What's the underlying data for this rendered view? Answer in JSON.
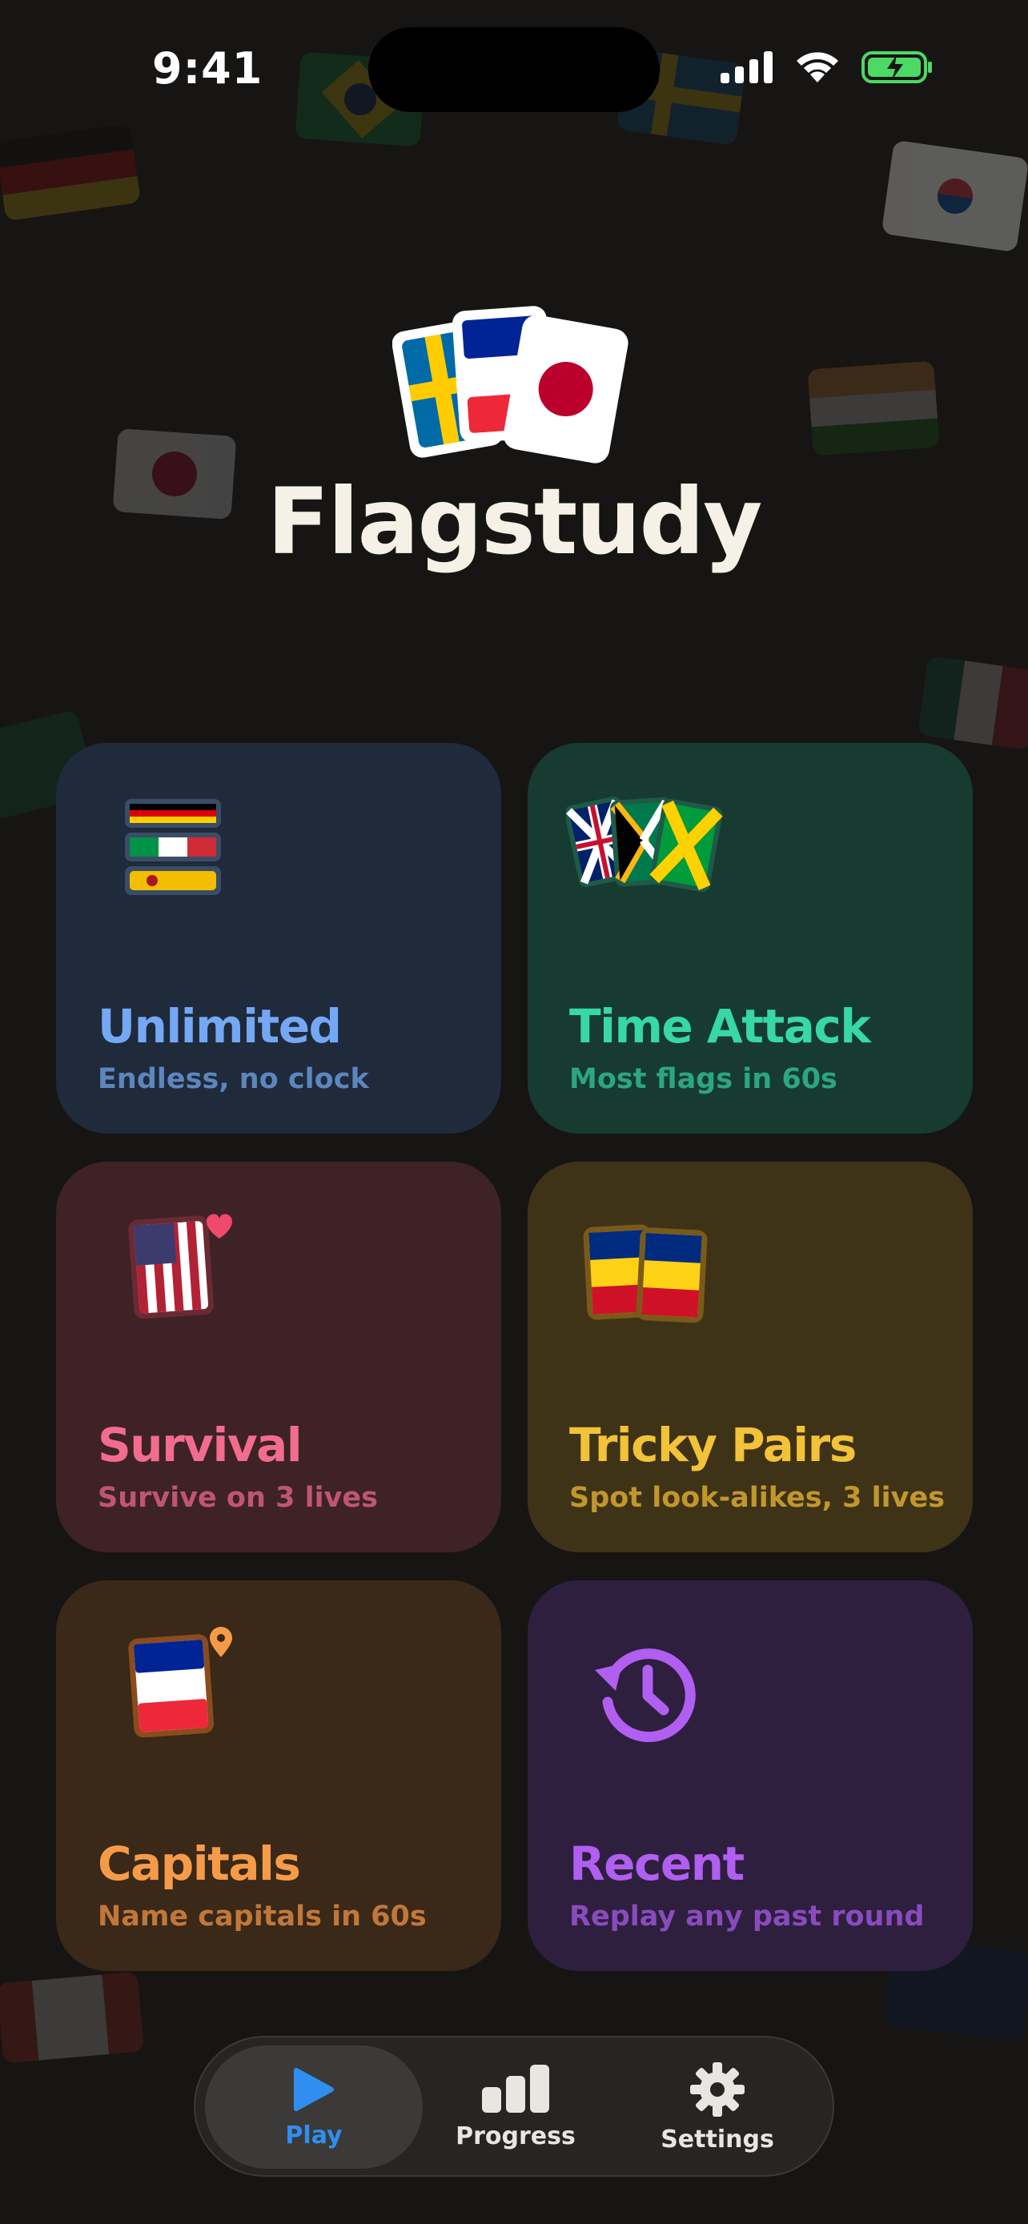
{
  "status_bar": {
    "time": "9:41"
  },
  "app": {
    "title": "Flagstudy"
  },
  "modes": [
    {
      "label": "Unlimited",
      "subtitle": "Endless, no clock",
      "accent": "#74a8f4"
    },
    {
      "label": "Time Attack",
      "subtitle": "Most flags in 60s",
      "accent": "#37d8a5"
    },
    {
      "label": "Survival",
      "subtitle": "Survive on 3 lives",
      "accent": "#f26c8e"
    },
    {
      "label": "Tricky Pairs",
      "subtitle": "Spot look-alikes, 3 lives",
      "accent": "#f2c238"
    },
    {
      "label": "Capitals",
      "subtitle": "Name capitals in 60s",
      "accent": "#f59b48"
    },
    {
      "label": "Recent",
      "subtitle": "Replay any past round",
      "accent": "#b05ff0"
    }
  ],
  "tabs": [
    {
      "label": "Play",
      "icon": "play-icon",
      "active": true
    },
    {
      "label": "Progress",
      "icon": "bar-chart-icon",
      "active": false
    },
    {
      "label": "Settings",
      "icon": "gear-icon",
      "active": false
    }
  ]
}
